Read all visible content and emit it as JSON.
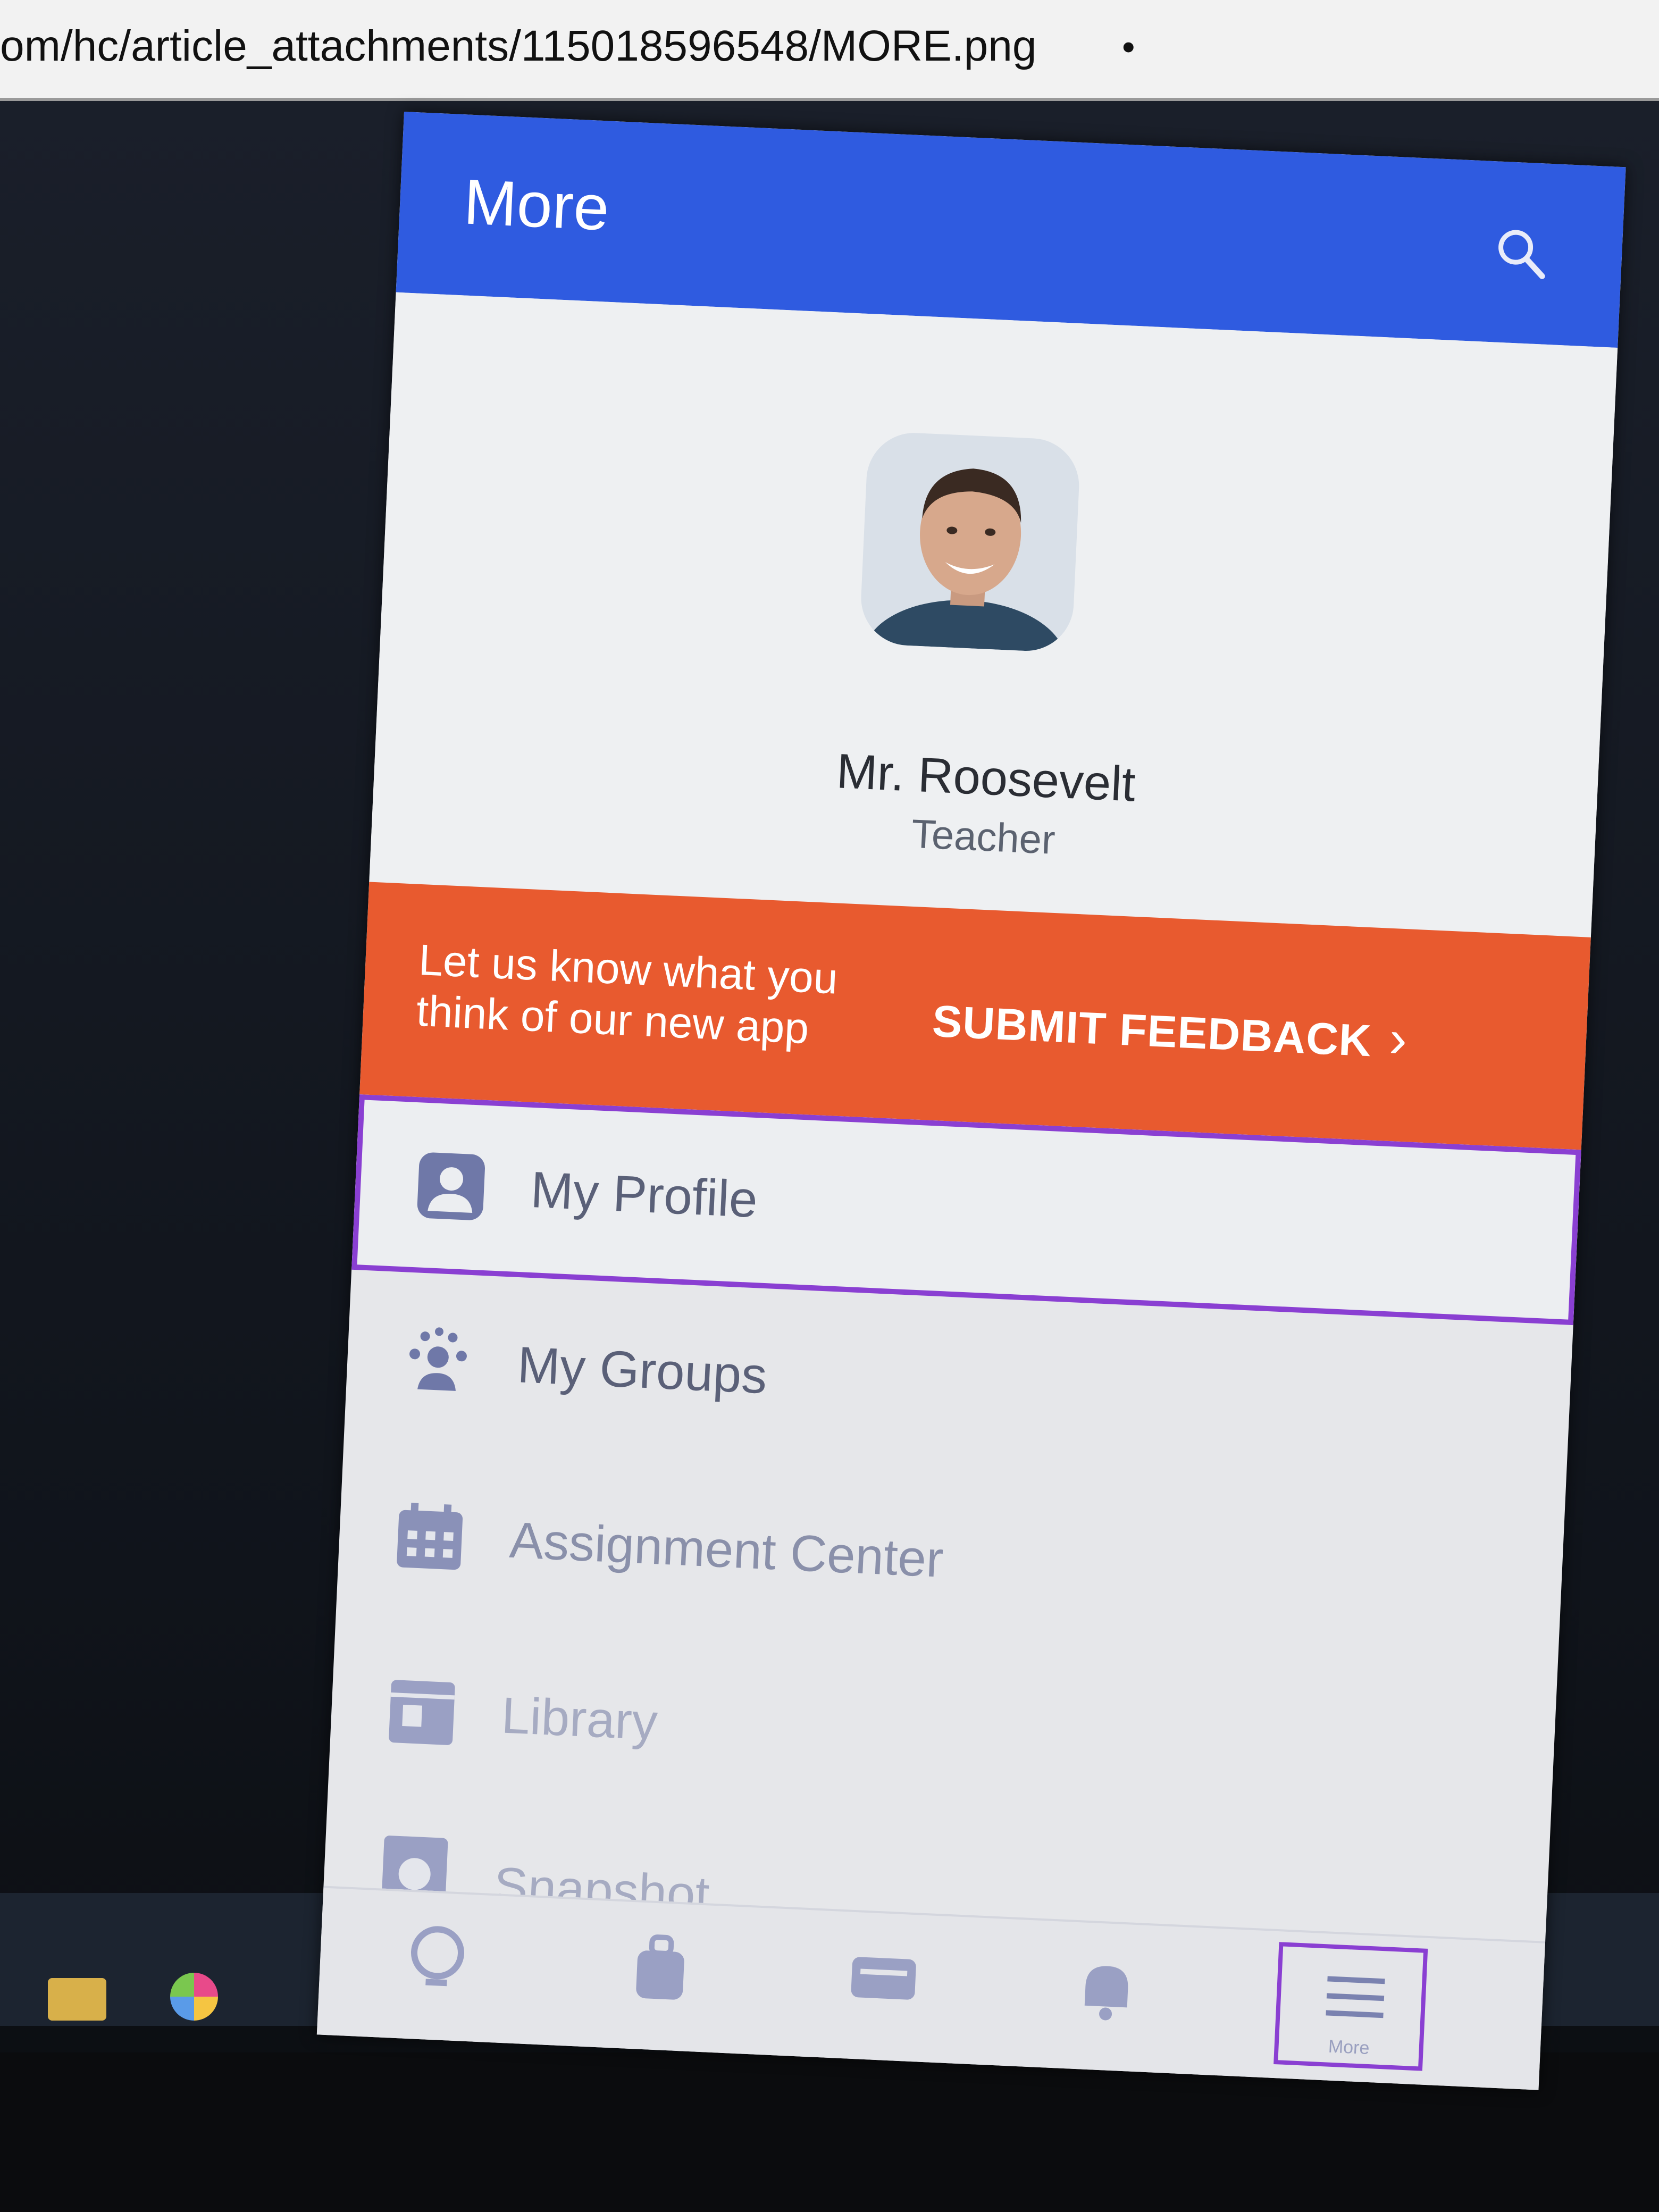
{
  "browser": {
    "url": "om/hc/article_attachments/115018596548/MORE.png"
  },
  "app": {
    "title": "More",
    "profile": {
      "name": "Mr. Roosevelt",
      "role": "Teacher"
    },
    "feedback": {
      "message": "Let us know what you think of our new app",
      "button_label": "SUBMIT FEEDBACK"
    },
    "menu": [
      {
        "label": "My Profile",
        "icon": "profile-icon",
        "active": true
      },
      {
        "label": "My Groups",
        "icon": "groups-icon"
      },
      {
        "label": "Assignment Center",
        "icon": "calendar-icon"
      },
      {
        "label": "Library",
        "icon": "library-icon"
      },
      {
        "label": "Snapshot",
        "icon": "snapshot-icon"
      }
    ],
    "bottom_nav": [
      {
        "label": "",
        "icon": "globe-icon"
      },
      {
        "label": "",
        "icon": "backpack-icon"
      },
      {
        "label": "",
        "icon": "message-icon"
      },
      {
        "label": "",
        "icon": "bell-icon"
      },
      {
        "label": "More",
        "icon": "hamburger-menu-icon",
        "active": true
      }
    ],
    "colors": {
      "appbar": "#2f5be0",
      "feedback": "#e85a2f",
      "selection": "#8a3fd2",
      "menu_icon": "#6f78a8"
    }
  }
}
